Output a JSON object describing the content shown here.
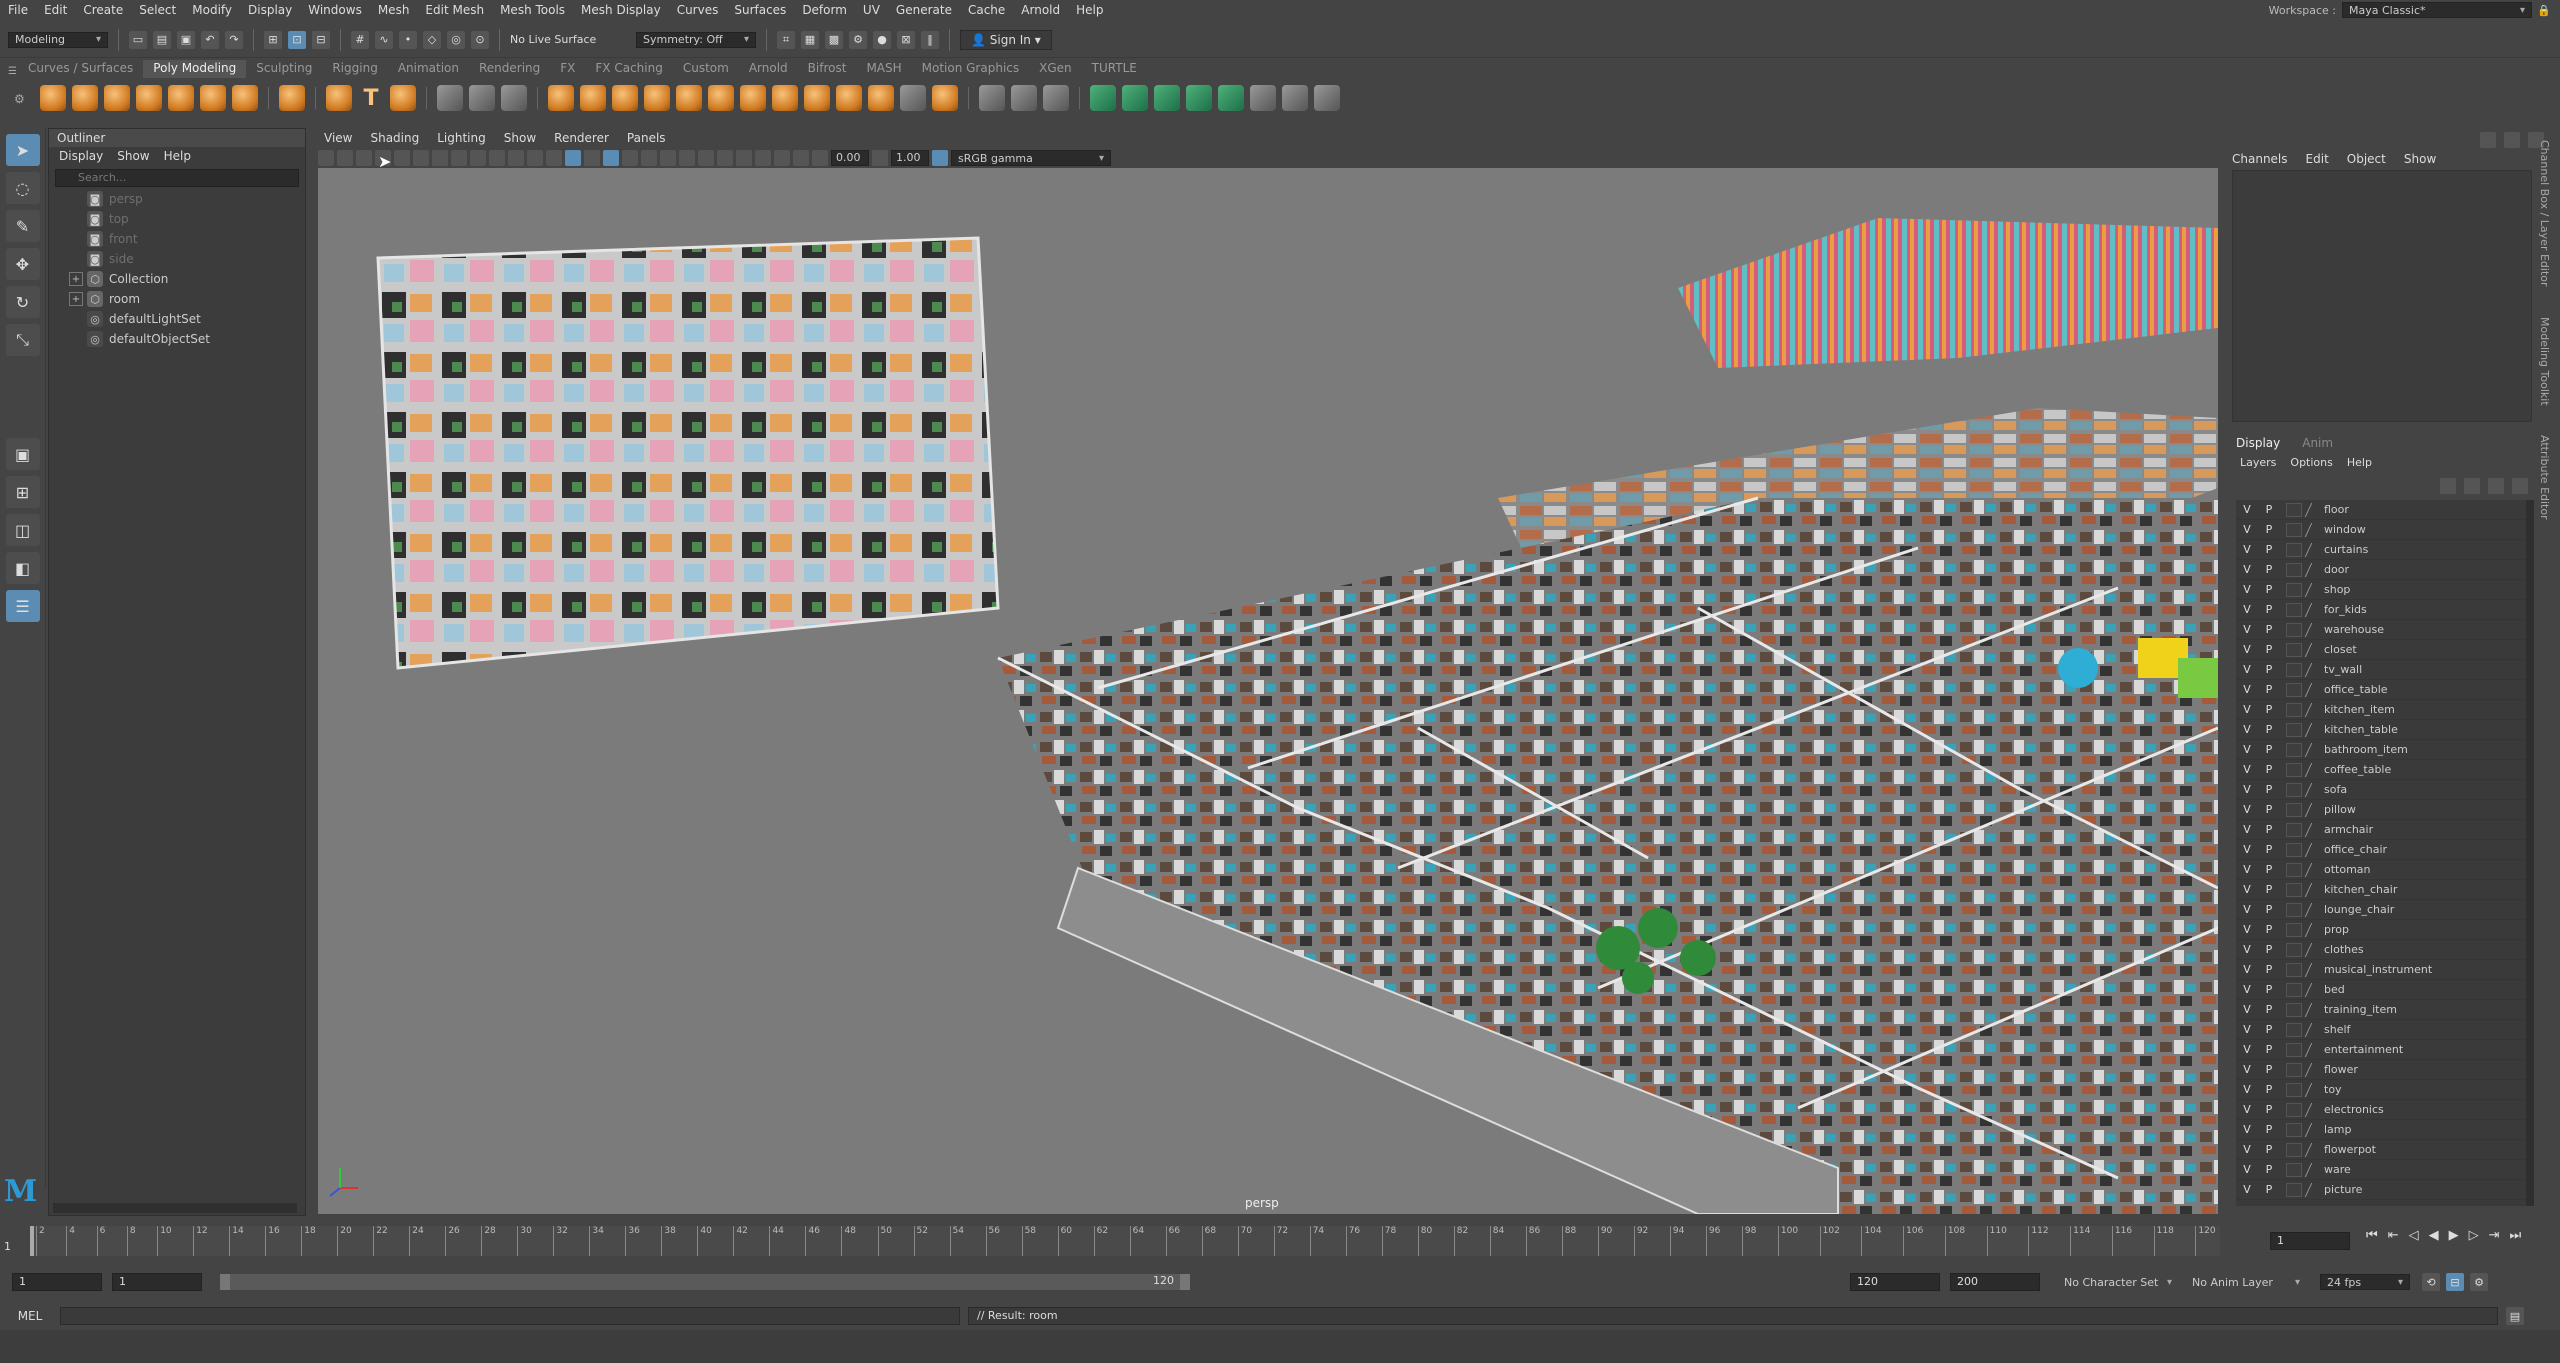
{
  "menubar": {
    "items": [
      "File",
      "Edit",
      "Create",
      "Select",
      "Modify",
      "Display",
      "Windows",
      "Mesh",
      "Edit Mesh",
      "Mesh Tools",
      "Mesh Display",
      "Curves",
      "Surfaces",
      "Deform",
      "UV",
      "Generate",
      "Cache",
      "Arnold",
      "Help"
    ],
    "workspace_label": "Workspace :",
    "workspace_value": "Maya Classic*"
  },
  "statusline": {
    "mode": "Modeling",
    "live_surface": "No Live Surface",
    "symmetry": "Symmetry: Off",
    "sign_in": "Sign In"
  },
  "shelf": {
    "tabs": [
      "Curves / Surfaces",
      "Poly Modeling",
      "Sculpting",
      "Rigging",
      "Animation",
      "Rendering",
      "FX",
      "FX Caching",
      "Custom",
      "Arnold",
      "Bifrost",
      "MASH",
      "Motion Graphics",
      "XGen",
      "TURTLE"
    ],
    "active_tab": "Poly Modeling"
  },
  "outliner": {
    "title": "Outliner",
    "menu": [
      "Display",
      "Show",
      "Help"
    ],
    "search_placeholder": "Search...",
    "items": [
      {
        "label": "persp",
        "dim": true,
        "expand": false,
        "icon": "camera-icon"
      },
      {
        "label": "top",
        "dim": true,
        "expand": false,
        "icon": "camera-icon"
      },
      {
        "label": "front",
        "dim": true,
        "expand": false,
        "icon": "camera-icon"
      },
      {
        "label": "side",
        "dim": true,
        "expand": false,
        "icon": "camera-icon"
      },
      {
        "label": "Collection",
        "dim": false,
        "expand": true,
        "icon": "group-icon"
      },
      {
        "label": "room",
        "dim": false,
        "expand": true,
        "icon": "group-icon"
      },
      {
        "label": "defaultLightSet",
        "dim": false,
        "expand": false,
        "icon": "set-icon"
      },
      {
        "label": "defaultObjectSet",
        "dim": false,
        "expand": false,
        "icon": "set-icon"
      }
    ]
  },
  "viewport": {
    "menu": [
      "View",
      "Shading",
      "Lighting",
      "Show",
      "Renderer",
      "Panels"
    ],
    "exposure": "0.00",
    "gamma": "1.00",
    "color_space": "sRGB gamma",
    "camera_label": "persp"
  },
  "channelbox": {
    "menu": [
      "Channels",
      "Edit",
      "Object",
      "Show"
    ],
    "side_tabs": [
      "Channel Box / Layer Editor",
      "Modeling Toolkit",
      "Attribute Editor"
    ]
  },
  "layers": {
    "tabs": [
      "Display",
      "Anim"
    ],
    "active_tab": "Display",
    "menu": [
      "Layers",
      "Options",
      "Help"
    ],
    "v": "V",
    "p": "P",
    "items": [
      "floor",
      "window",
      "curtains",
      "door",
      "shop",
      "for_kids",
      "warehouse",
      "closet",
      "tv_wall",
      "office_table",
      "kitchen_item",
      "kitchen_table",
      "bathroom_item",
      "coffee_table",
      "sofa",
      "pillow",
      "armchair",
      "office_chair",
      "ottoman",
      "kitchen_chair",
      "lounge_chair",
      "prop",
      "clothes",
      "musical_instrument",
      "bed",
      "training_item",
      "shelf",
      "entertainment",
      "flower",
      "toy",
      "electronics",
      "lamp",
      "flowerpot",
      "ware",
      "picture"
    ]
  },
  "timeline": {
    "current_frame": "1",
    "ticks": [
      "2",
      "4",
      "6",
      "8",
      "10",
      "12",
      "14",
      "16",
      "18",
      "20",
      "22",
      "24",
      "26",
      "28",
      "30",
      "32",
      "34",
      "36",
      "38",
      "40",
      "42",
      "44",
      "46",
      "48",
      "50",
      "52",
      "54",
      "56",
      "58",
      "60",
      "62",
      "64",
      "66",
      "68",
      "70",
      "72",
      "74",
      "76",
      "78",
      "80",
      "82",
      "84",
      "86",
      "88",
      "90",
      "92",
      "94",
      "96",
      "98",
      "100",
      "102",
      "104",
      "106",
      "108",
      "110",
      "112",
      "114",
      "116",
      "118",
      "120"
    ]
  },
  "range": {
    "start": "1",
    "start2": "1",
    "slider_start": "1",
    "slider_end": "120",
    "end": "120",
    "end2": "200",
    "character_set": "No Character Set",
    "anim_layer": "No Anim Layer",
    "fps": "24 fps"
  },
  "cmd": {
    "lang": "MEL",
    "result": "// Result: room"
  },
  "colors": {
    "accent": "#5b8db4",
    "viewport_bg": "#7b7b7b",
    "shelf_orange": "#e08a2a",
    "shelf_green": "#2f9a63"
  }
}
